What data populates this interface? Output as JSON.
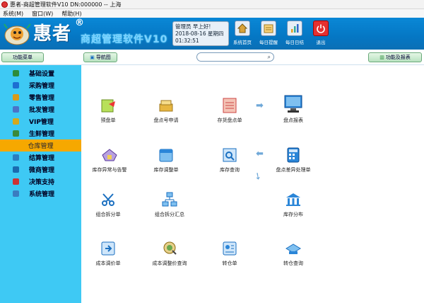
{
  "window": {
    "title": "惠者-商超管理软件V10 DN:000000 -- 上海"
  },
  "menu": [
    "系统(M)",
    "窗口(W)",
    "帮助(H)"
  ],
  "brand": {
    "main": "惠者",
    "reg": "®",
    "sub": "商超管理软件V10"
  },
  "user": {
    "greeting": "管理员  早上好!",
    "date": "2018-08-16",
    "weekday": "星期四",
    "time": "01:32:51"
  },
  "top_buttons": [
    {
      "label": "系统首页",
      "icon": "home-icon"
    },
    {
      "label": "每日提醒",
      "icon": "reminder-icon"
    },
    {
      "label": "每日日结",
      "icon": "daily-close-icon"
    },
    {
      "label": "退出",
      "icon": "power-icon"
    }
  ],
  "toolbar": {
    "menu_label": "功能菜单",
    "nav_label": "导航图",
    "report_label": "功能及报表"
  },
  "sidebar": [
    {
      "label": "基础设置",
      "color": "#2d8b3a"
    },
    {
      "label": "采购管理",
      "color": "#1d6fd2"
    },
    {
      "label": "零售管理",
      "color": "#d89a1a"
    },
    {
      "label": "批发管理",
      "color": "#4a73c9"
    },
    {
      "label": "VIP管理",
      "color": "#d6a81c"
    },
    {
      "label": "生鲜管理",
      "color": "#3a8a3a"
    },
    {
      "label": "仓库管理",
      "color": "#f6a800"
    },
    {
      "label": "结算管理",
      "color": "#2c7fc1"
    },
    {
      "label": "微商管理",
      "color": "#1a6bb0"
    },
    {
      "label": "决策支持",
      "color": "#c33"
    },
    {
      "label": "系统管理",
      "color": "#3a7cc0"
    }
  ],
  "active_sidebar": "仓库管理",
  "main_items": [
    {
      "label": "预盘单",
      "icon": "pre-check-icon",
      "color": "#9fd04a"
    },
    {
      "label": "盘点号申请",
      "icon": "stock-number-icon",
      "color": "#e7b640"
    },
    {
      "label": "存货盘点单",
      "icon": "inventory-sheet-icon",
      "color": "#e86b5a"
    },
    {
      "label": "盘点报表",
      "icon": "stocktake-report-icon",
      "color": "#2b86d8"
    },
    {
      "label": "库存异常与告警",
      "icon": "stock-alert-icon",
      "color": "#8a6fc8"
    },
    {
      "label": "库存调整单",
      "icon": "stock-adjust-icon",
      "color": "#2b86d8"
    },
    {
      "label": "库存查询",
      "icon": "stock-query-icon",
      "color": "#2b86d8"
    },
    {
      "label": "盘点差异处理单",
      "icon": "difference-icon",
      "color": "#2b86d8"
    },
    {
      "label": "组合拆分单",
      "icon": "combo-split-icon",
      "color": "#2b86d8"
    },
    {
      "label": "组合拆分汇总",
      "icon": "combo-summary-icon",
      "color": "#2b86d8"
    },
    {
      "label": "库存分布",
      "icon": "stock-distribution-icon",
      "color": "#2b86d8"
    },
    {
      "label": "成本调价单",
      "icon": "cost-adjust-icon",
      "color": "#2b86d8"
    },
    {
      "label": "成本调整价查询",
      "icon": "cost-query-icon",
      "color": "#6aa84f"
    },
    {
      "label": "转仓单",
      "icon": "transfer-icon",
      "color": "#2b86d8"
    },
    {
      "label": "转仓查询",
      "icon": "transfer-query-icon",
      "color": "#2b86d8"
    }
  ]
}
